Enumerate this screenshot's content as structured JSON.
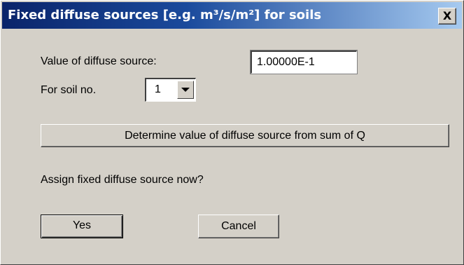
{
  "window": {
    "title": "Fixed diffuse sources [e.g. m³/s/m²] for soils",
    "close_label": "X"
  },
  "form": {
    "value_label": "Value of diffuse source:",
    "value": "1.00000E-1",
    "soil_label": "For soil no.",
    "soil_selected": "1"
  },
  "buttons": {
    "determine_label": "Determine value of diffuse source from sum of Q",
    "yes_label": "Yes",
    "cancel_label": "Cancel"
  },
  "prompt": {
    "question": "Assign fixed diffuse source now?"
  },
  "colors": {
    "titlebar_start": "#0a246a",
    "titlebar_end": "#a6caf0",
    "dialog_background": "#d4d0c8"
  }
}
